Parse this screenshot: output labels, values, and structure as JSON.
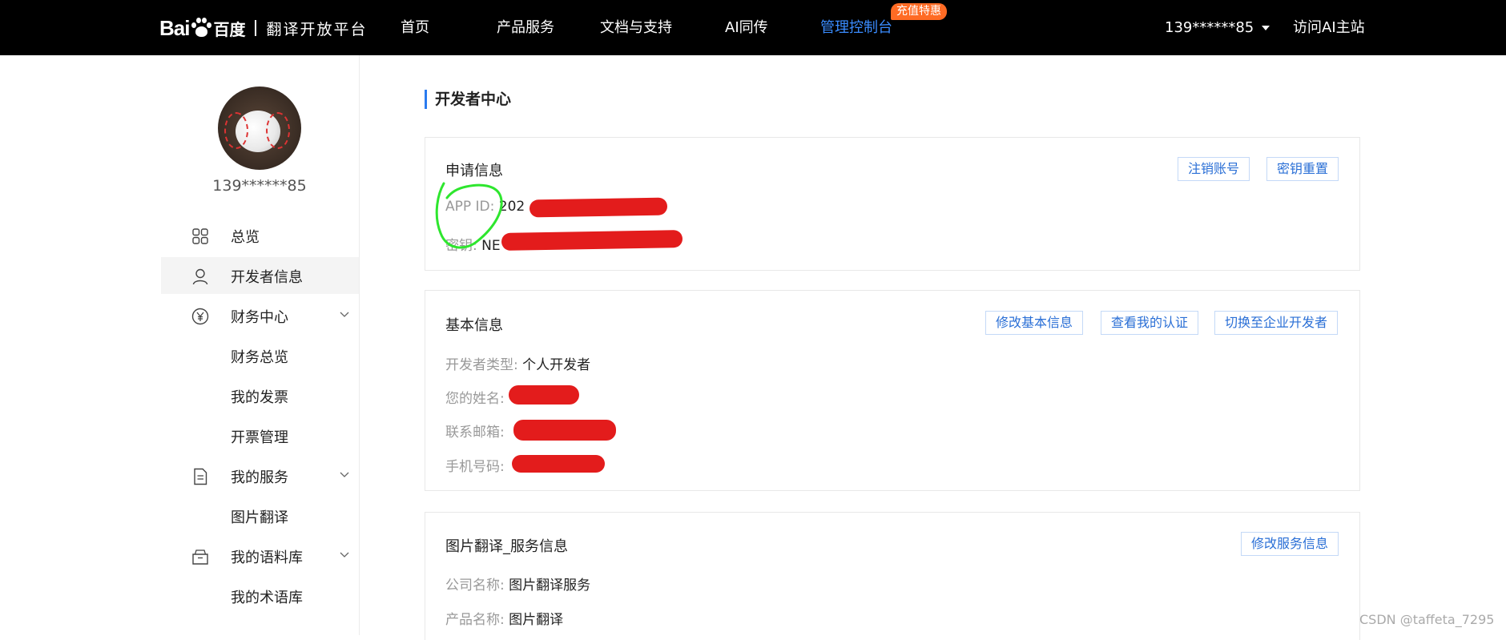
{
  "header": {
    "logo_bai": "Bai",
    "logo_cn": "百度",
    "logo_sub": "翻译开放平台",
    "nav": [
      "首页",
      "产品服务",
      "文档与支持",
      "AI同传",
      "管理控制台"
    ],
    "promo_badge": "充值特惠",
    "account": "139******85",
    "visit_link": "访问AI主站",
    "active_color": "#3a8cff",
    "badge_color": "#ff6b24"
  },
  "sidebar": {
    "username": "139******85",
    "menu": {
      "overview": "总览",
      "developer_info": "开发者信息",
      "finance_center": "财务中心",
      "finance_overview": "财务总览",
      "my_invoices": "我的发票",
      "invoice_management": "开票管理",
      "my_services": "我的服务",
      "image_translation": "图片翻译",
      "my_corpus": "我的语料库",
      "my_terms": "我的术语库"
    }
  },
  "main": {
    "title": "开发者中心",
    "application": {
      "title": "申请信息",
      "cancel_account": "注销账号",
      "reset_key": "密钥重置",
      "appid_label": "APP ID:",
      "appid_value": "202",
      "key_label": "密钥:",
      "key_value": "NE"
    },
    "basic": {
      "title": "基本信息",
      "edit_basic": "修改基本信息",
      "view_cert": "查看我的认证",
      "switch_enterprise": "切换至企业开发者",
      "type_label": "开发者类型:",
      "type_value": "个人开发者",
      "name_label": "您的姓名:",
      "email_label": "联系邮箱:",
      "phone_label": "手机号码:"
    },
    "service": {
      "title": "图片翻译_服务信息",
      "edit_service": "修改服务信息",
      "company_label": "公司名称:",
      "company_value": "图片翻译服务",
      "product_label": "产品名称:",
      "product_value": "图片翻译"
    }
  },
  "watermark": "CSDN @taffeta_7295",
  "colors": {
    "redaction": "#e31c1c",
    "annotation": "#2ee62e",
    "accent": "#2a7bef"
  }
}
